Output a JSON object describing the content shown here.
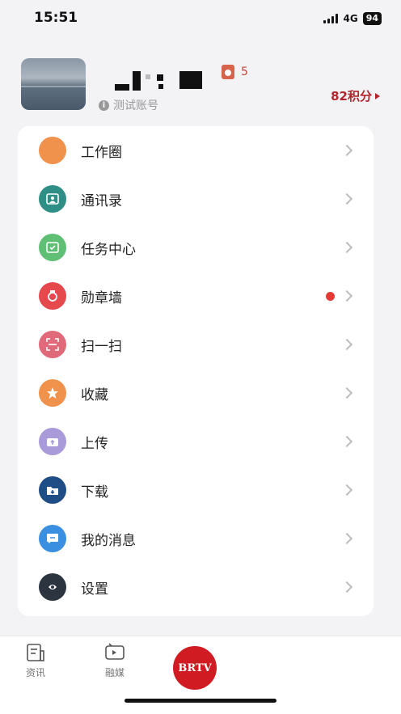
{
  "status_bar": {
    "time": "15:51",
    "network": "4G",
    "battery": "94"
  },
  "profile": {
    "medal_count": "5",
    "account_label": "测试账号",
    "points": "82积分"
  },
  "menu": [
    {
      "label": "工作圈",
      "icon": "compass-icon",
      "color": "#f0914c"
    },
    {
      "label": "通讯录",
      "icon": "contacts-icon",
      "color": "#2f8f86"
    },
    {
      "label": "任务中心",
      "icon": "task-icon",
      "color": "#5fbf74"
    },
    {
      "label": "勋章墙",
      "icon": "medal-icon",
      "color": "#e5484d",
      "badge": true
    },
    {
      "label": "扫一扫",
      "icon": "scan-icon",
      "color": "#e0697a"
    },
    {
      "label": "收藏",
      "icon": "star-icon",
      "color": "#f0914c"
    },
    {
      "label": "上传",
      "icon": "upload-icon",
      "color": "#a99ad9"
    },
    {
      "label": "下载",
      "icon": "download-icon",
      "color": "#1f4e86"
    },
    {
      "label": "我的消息",
      "icon": "message-icon",
      "color": "#3b8fe0"
    },
    {
      "label": "设置",
      "icon": "gear-icon",
      "color": "#2c3440"
    }
  ],
  "tabs": {
    "news": "资讯",
    "media": "融媒",
    "brtv": "BRTV"
  }
}
